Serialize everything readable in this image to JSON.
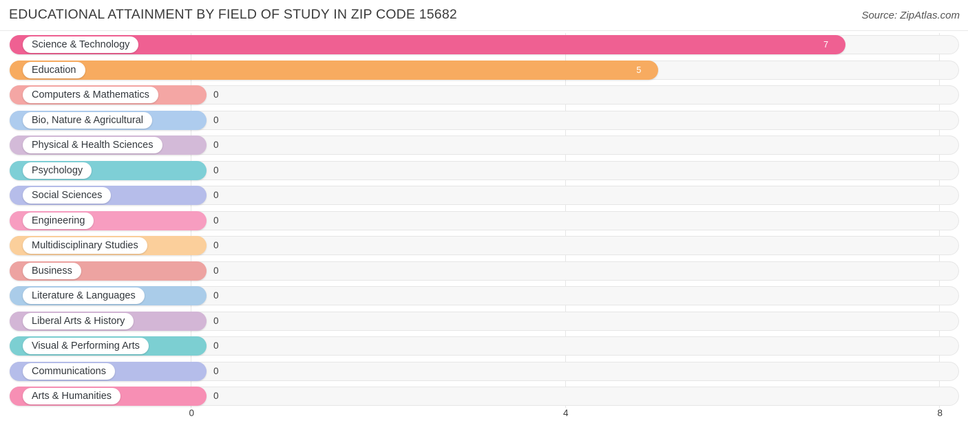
{
  "header": {
    "title": "EDUCATIONAL ATTAINMENT BY FIELD OF STUDY IN ZIP CODE 15682",
    "source": "Source: ZipAtlas.com"
  },
  "chart_data": {
    "type": "bar",
    "orientation": "horizontal",
    "title": "EDUCATIONAL ATTAINMENT BY FIELD OF STUDY IN ZIP CODE 15682",
    "xlabel": "",
    "ylabel": "",
    "xlim": [
      0,
      8
    ],
    "xticks": [
      "0",
      "4",
      "8"
    ],
    "xtick_values": [
      0,
      4,
      8
    ],
    "grid": true,
    "legend": "none",
    "categories": [
      "Science & Technology",
      "Education",
      "Computers & Mathematics",
      "Bio, Nature & Agricultural",
      "Physical & Health Sciences",
      "Psychology",
      "Social Sciences",
      "Engineering",
      "Multidisciplinary Studies",
      "Business",
      "Literature & Languages",
      "Liberal Arts & History",
      "Visual & Performing Arts",
      "Communications",
      "Arts & Humanities"
    ],
    "values": [
      7,
      5,
      0,
      0,
      0,
      0,
      0,
      0,
      0,
      0,
      0,
      0,
      0,
      0,
      0
    ],
    "value_labels": [
      "7",
      "5",
      "0",
      "0",
      "0",
      "0",
      "0",
      "0",
      "0",
      "0",
      "0",
      "0",
      "0",
      "0",
      "0"
    ],
    "colors": [
      "#ef6092",
      "#f7ab60",
      "#f4a6a4",
      "#aeccee",
      "#d3bad8",
      "#7ecfd6",
      "#b6bdea",
      "#f79dc0",
      "#fbcf9b",
      "#eda3a1",
      "#aacce9",
      "#d3b6d6",
      "#7ccfd2",
      "#b5bdea",
      "#f78fb4"
    ]
  },
  "colors": {
    "background": "#ffffff",
    "track": "#f7f7f7",
    "track_border": "#e6e6e6",
    "gridline": "#e6e6e6",
    "text": "#3b3b3b",
    "label_text": "#33383d",
    "value_in_bar": "#ffffff"
  }
}
